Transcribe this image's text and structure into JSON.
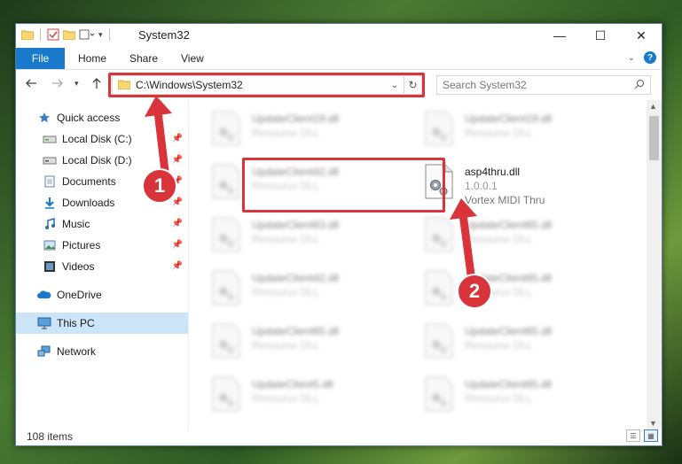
{
  "window": {
    "title": "System32",
    "controls": {
      "minimize": "—",
      "maximize": "☐",
      "close": "✕"
    }
  },
  "ribbon": {
    "tabs": [
      "File",
      "Home",
      "Share",
      "View"
    ]
  },
  "address": {
    "path": "C:\\Windows\\System32",
    "search_placeholder": "Search System32"
  },
  "nav": {
    "items": [
      {
        "label": "Quick access",
        "icon": "star-icon"
      },
      {
        "label": "Local Disk (C:)",
        "icon": "drive-icon"
      },
      {
        "label": "Local Disk (D:)",
        "icon": "drive-icon"
      },
      {
        "label": "Documents",
        "icon": "documents-icon"
      },
      {
        "label": "Downloads",
        "icon": "download-icon"
      },
      {
        "label": "Music",
        "icon": "music-icon"
      },
      {
        "label": "Pictures",
        "icon": "pictures-icon"
      },
      {
        "label": "Videos",
        "icon": "videos-icon"
      },
      {
        "label": "OneDrive",
        "icon": "cloud-icon"
      },
      {
        "label": "This PC",
        "icon": "computer-icon"
      },
      {
        "label": "Network",
        "icon": "network-icon"
      }
    ]
  },
  "files": {
    "left": [
      {
        "name": "UpdateClient19.dll",
        "type": "Resource DLL"
      },
      {
        "name": "UpdateClient42.dll",
        "type": "Resource DLL"
      },
      {
        "name": "UpdateClient63.dll",
        "type": "Resource DLL"
      },
      {
        "name": "UpdateClient42.dll",
        "type": "Resource DLL"
      },
      {
        "name": "UpdateClient65.dll",
        "type": "Resource DLL"
      },
      {
        "name": "UpdateClient5.dll",
        "type": "Resource DLL"
      }
    ],
    "right": [
      {
        "name": "UpdateClient19.dll",
        "type": "Resource DLL"
      },
      {
        "name": "asp4thru.dll",
        "version": "1.0.0.1",
        "description": "Vortex MIDI Thru"
      },
      {
        "name": "UpdateClient65.dll",
        "type": "Resource DLL"
      },
      {
        "name": "UpdateClient65.dll",
        "type": "Resource DLL"
      },
      {
        "name": "UpdateClient65.dll",
        "type": "Resource DLL"
      },
      {
        "name": "UpdateClient65.dll",
        "type": "Resource DLL"
      }
    ]
  },
  "status": {
    "item_count": "108 items"
  },
  "annotations": {
    "step1": "1",
    "step2": "2"
  },
  "colors": {
    "accent": "#1979ca",
    "highlight": "#d9343a",
    "selected": "#cce4f7"
  }
}
